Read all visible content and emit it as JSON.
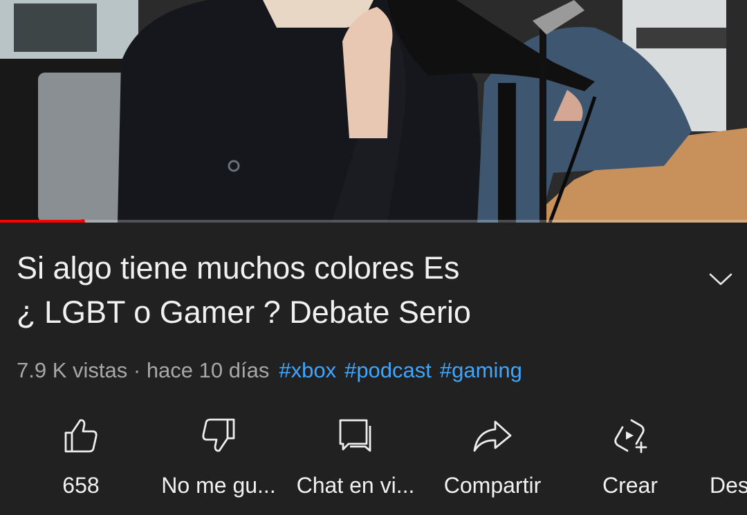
{
  "video": {
    "progress_fraction": 0.11,
    "progress_color": "#ff0000"
  },
  "title": {
    "line1": "Si algo tiene muchos colores Es",
    "line2": "¿ LGBT o Gamer ? Debate Serio"
  },
  "meta": {
    "views": "7.9 K vistas",
    "separator": " · ",
    "age": "hace 10 días",
    "hashtags": [
      "#xbox",
      "#podcast",
      "#gaming"
    ]
  },
  "actions": [
    {
      "label": "658",
      "icon": "thumbs-up-icon"
    },
    {
      "label": "No me gu...",
      "icon": "thumbs-down-icon"
    },
    {
      "label": "Chat en vi...",
      "icon": "chat-icon"
    },
    {
      "label": "Compartir",
      "icon": "share-icon"
    },
    {
      "label": "Crear",
      "icon": "create-icon"
    },
    {
      "label": "Des",
      "icon": "download-icon"
    }
  ],
  "colors": {
    "background": "#212121",
    "text": "#f1f1f1",
    "muted": "#a8a8a8",
    "hashtag": "#3ea6ff"
  }
}
